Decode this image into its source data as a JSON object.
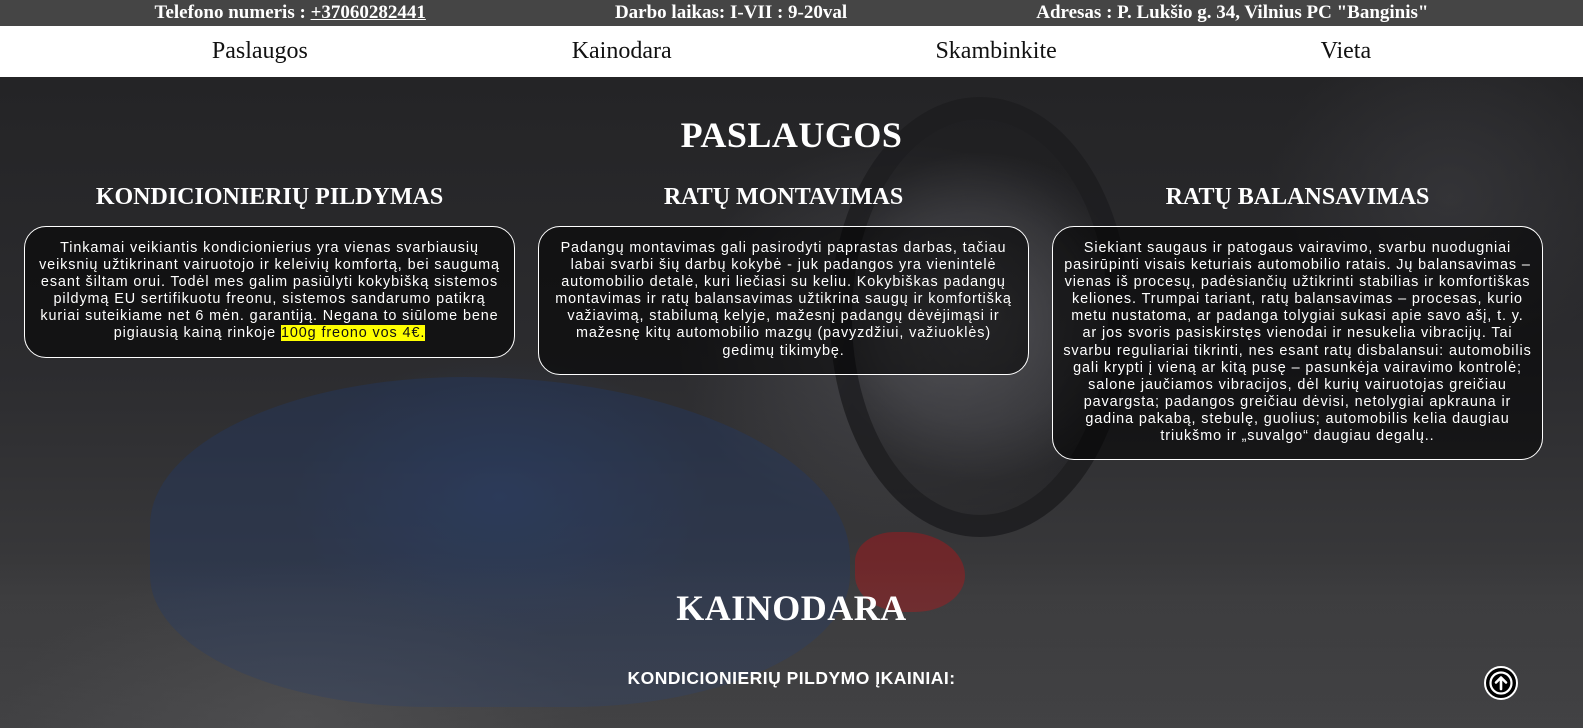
{
  "topbar": {
    "phone_label": "Telefono numeris :",
    "phone_number": "+37060282441",
    "hours": "Darbo laikas: I-VII : 9-20val",
    "address": "Adresas : P. Lukšio g. 34, Vilnius PC \"Banginis\""
  },
  "nav": {
    "items": [
      {
        "label": "Paslaugos"
      },
      {
        "label": "Kainodara"
      },
      {
        "label": "Skambinkite"
      },
      {
        "label": "Vieta"
      }
    ]
  },
  "services_section": {
    "title": "PASLAUGOS",
    "items": [
      {
        "title": "KONDICIONIERIŲ PILDYMAS",
        "text": "Tinkamai veikiantis kondicionierius yra vienas svarbiausių veiksnių užtikrinant vairuotojo ir keleivių komfortą, bei saugumą esant šiltam orui. Todėl mes galim pasiūlyti kokybišką sistemos pildymą EU sertifikuotu freonu, sistemos sandarumo patikrą kuriai suteikiame net 6 mėn. garantiją. Negana to siūlome bene pigiausią kainą rinkoje ",
        "highlight": "100g freono vos 4€."
      },
      {
        "title": "RATŲ MONTAVIMAS",
        "text": "Padangų montavimas gali pasirodyti paprastas darbas, tačiau labai svarbi šių darbų kokybė - juk padangos yra vienintelė automobilio detalė, kuri liečiasi su keliu. Kokybiškas padangų montavimas ir ratų balansavimas užtikrina saugų ir komfortišką važiavimą, stabilumą kelyje, mažesnį padangų dėvėjimąsi ir mažesnę kitų automobilio mazgų (pavyzdžiui, važiuoklės) gedimų tikimybę."
      },
      {
        "title": "RATŲ BALANSAVIMAS",
        "text": "Siekiant saugaus ir patogaus vairavimo, svarbu nuodugniai pasirūpinti visais keturiais automobilio ratais. Jų balansavimas – vienas iš procesų, padėsiančių užtikrinti stabilias ir komfortiškas keliones. Trumpai tariant, ratų balansavimas – procesas, kurio metu nustatoma, ar padanga tolygiai sukasi apie savo ašį, t. y. ar jos svoris pasiskirstęs vienodai ir nesukelia vibracijų. Tai svarbu reguliariai tikrinti, nes esant ratų disbalansui: automobilis gali krypti į vieną ar kitą pusę – pasunkėja vairavimo kontrolė; salone jaučiamos vibracijos, dėl kurių vairuotojas greičiau pavargsta; padangos greičiau dėvisi, netolygiai apkrauna ir gadina pakabą, stebulę, guolius; automobilis kelia daugiau triukšmo ir „suvalgo“ daugiau degalų.."
      }
    ]
  },
  "pricing_section": {
    "title": "KAINODARA",
    "subtitle": "KONDICIONIERIŲ PILDYMO ĮKAINIAI:"
  },
  "scroll_top": {
    "icon": "arrow-up-circle-icon"
  }
}
